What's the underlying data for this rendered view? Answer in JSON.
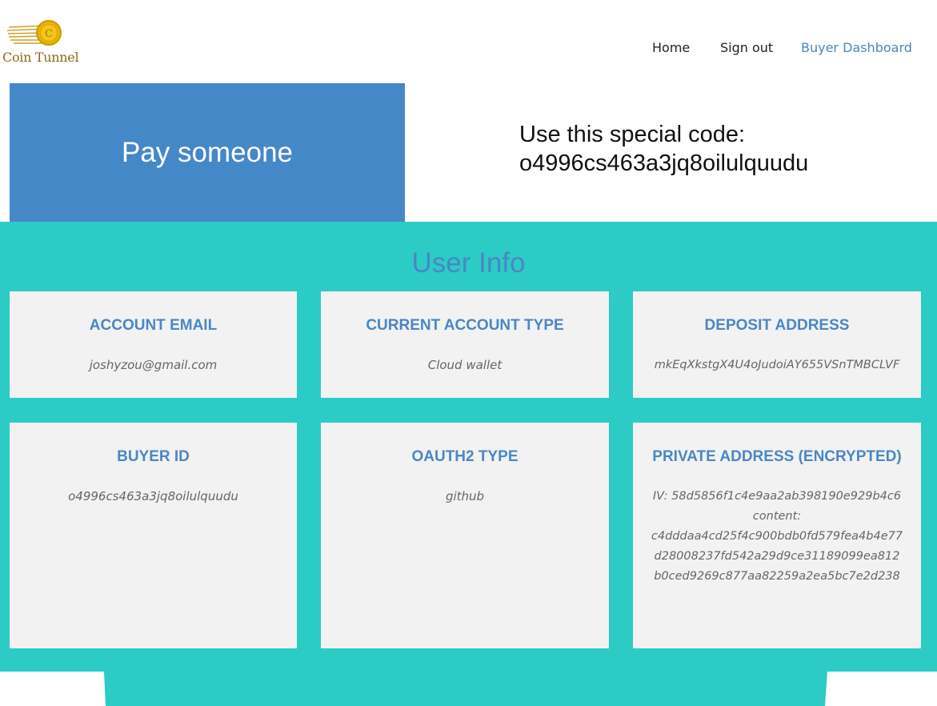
{
  "brand": {
    "name": "Coin Tunnel",
    "icon": "coin-logo-icon"
  },
  "nav": {
    "home": "Home",
    "sign_out": "Sign out",
    "buyer_dashboard": "Buyer Dashboard"
  },
  "colors": {
    "accent": "#4588c8",
    "teal": "#2ccbc5",
    "card_bg": "#f2f2f2",
    "link_blue": "#4a87c6",
    "logo_gold": "#e8b400"
  },
  "pay_button": {
    "label": "Pay someone"
  },
  "special_code": {
    "label": "Use this special code:",
    "code": "o4996cs463a3jq8oilulquudu"
  },
  "user_info": {
    "title": "User Info",
    "cards": [
      {
        "title": "ACCOUNT EMAIL",
        "value": "joshyzou@gmail.com"
      },
      {
        "title": "CURRENT ACCOUNT TYPE",
        "value": "Cloud wallet"
      },
      {
        "title": "DEPOSIT ADDRESS",
        "value": "mkEqXkstgX4U4oJudoiAY655VSnTMBCLVF"
      },
      {
        "title": "BUYER ID",
        "value": "o4996cs463a3jq8oilulquudu"
      },
      {
        "title": "OAUTH2 TYPE",
        "value": "github"
      },
      {
        "title": "PRIVATE ADDRESS (ENCRYPTED)",
        "iv": "IV: 58d5856f1c4e9aa2ab398190e929b4c6",
        "content_label": "content:",
        "content": "c4dddaa4cd25f4c900bdb0fd579fea4b4e77d28008237fd542a29d9ce31189099ea812b0ced9269c877aa82259a2ea5bc7e2d238"
      }
    ]
  }
}
